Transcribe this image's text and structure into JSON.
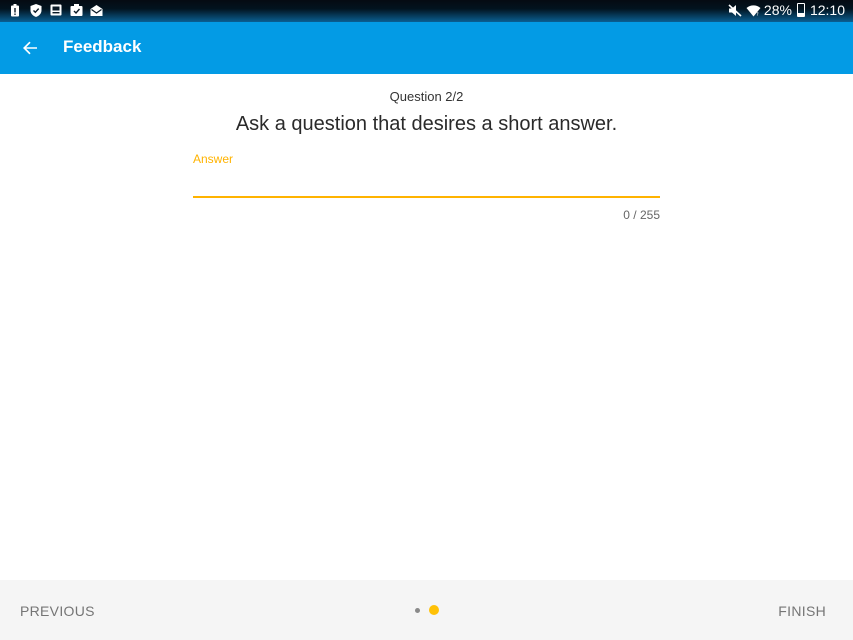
{
  "status_bar": {
    "left_icons": [
      "battery-alert-icon",
      "shield-icon",
      "gallery-icon",
      "mail-check-icon",
      "mail-open-icon"
    ],
    "battery_percent": "28%",
    "battery_level": 0.28,
    "time": "12:10"
  },
  "app_bar": {
    "title": "Feedback",
    "back_icon": "arrow-back-icon",
    "color": "#039be5"
  },
  "question": {
    "counter": "Question 2/2",
    "text": "Ask a question that desires a short answer."
  },
  "answer": {
    "label": "Answer",
    "value": "",
    "char_count": "0 / 255",
    "accent_color": "#ffb300"
  },
  "bottom_nav": {
    "previous_label": "PREVIOUS",
    "finish_label": "FINISH",
    "page_count": 2,
    "current_page": 2
  }
}
